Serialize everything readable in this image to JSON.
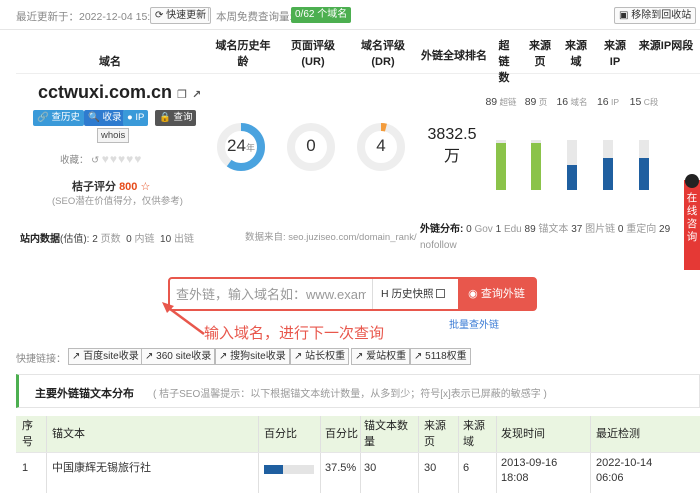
{
  "topbar": {
    "last_update": "最近更新于：2022-12-04 15:23",
    "refresh_label": "快速更新",
    "quota_label": "本周免费查询量:",
    "quota_badge": "0/62 个域名",
    "recycle_label": "移除到回收站"
  },
  "columns": {
    "domain": "域名",
    "age": "域名历史年龄",
    "page_rank": "页面评级(UR)",
    "domain_rank": "域名评级(DR)",
    "global_rank": "外链全球排名",
    "superlinks": "超链数",
    "source_pages": "来源页",
    "source_domains": "来源域",
    "source_ip": "来源IP",
    "source_ip_segments": "来源IP网段"
  },
  "site": {
    "domain": "cctwuxi.com.cn",
    "tags": [
      "查历史",
      "收录",
      "IP",
      "查询"
    ],
    "whois": "whois",
    "collect_label": "收藏：",
    "score_label": "桔子评分",
    "score_value": "800",
    "score_note": "(SEO潜在价值得分，仅供参考)"
  },
  "metrics": {
    "age": "24",
    "age_unit": "年",
    "age_fraction": 0.6,
    "ur": "0",
    "ur_fraction": 0,
    "dr": "4",
    "dr_fraction": 0.04,
    "global_rank": "3832.5万"
  },
  "links": [
    {
      "value": "89",
      "unit": "超链",
      "fraction": 0.95,
      "color": "#8bc34a"
    },
    {
      "value": "89",
      "unit": "页",
      "fraction": 0.95,
      "color": "#8bc34a"
    },
    {
      "value": "16",
      "unit": "域名",
      "fraction": 0.5,
      "color": "#1f5fa0"
    },
    {
      "value": "16",
      "unit": "IP",
      "fraction": 0.65,
      "color": "#1f5fa0"
    },
    {
      "value": "15",
      "unit": "C段",
      "fraction": 0.65,
      "color": "#1f5fa0"
    }
  ],
  "station": {
    "label": "站内数据",
    "estimate": "(估值)",
    "pages_v": "2",
    "pages_u": "页数",
    "inner_v": "0",
    "inner_u": "内链",
    "out_v": "10",
    "out_u": "出链",
    "source_note": "数据来自: seo.juziseo.com/domain_rank/"
  },
  "outlink": {
    "label": "外链分布:",
    "items": [
      {
        "v": "0",
        "u": "Gov"
      },
      {
        "v": "1",
        "u": "Edu"
      },
      {
        "v": "89",
        "u": "锚文本"
      },
      {
        "v": "37",
        "u": "图片链"
      },
      {
        "v": "0",
        "u": "重定向"
      },
      {
        "v": "29",
        "u": "nofollow"
      }
    ]
  },
  "side_widget": "在线咨询",
  "search": {
    "placeholder": "查外链，输入域名如：www.example.com",
    "history_label": "H 历史快照",
    "button": "查询外链",
    "batch_link": "批量查外链"
  },
  "annotation": "输入域名，进行下一次查询",
  "quick": {
    "label": "快捷链接：",
    "buttons": [
      "百度site收录",
      "360 site收录",
      "搜狗site收录",
      "站长权重",
      "爱站权重",
      "5118权重"
    ]
  },
  "section": {
    "title": "主要外链锚文本分布",
    "note": "( 桔子SEO温馨提示：以下根据锚文本统计数量，从多到少；符号[x]表示已屏蔽的敏感字 )"
  },
  "table": {
    "headers": [
      "序号",
      "锚文本",
      "百分比",
      "百分比",
      "锚文本数量",
      "来源页",
      "来源域",
      "发现时间",
      "最近检测"
    ],
    "rows": [
      {
        "idx": "1",
        "anchor": "中国康辉无锡旅行社",
        "pct_fraction": 0.375,
        "pct": "37.5%",
        "count": "30",
        "pages": "30",
        "domains": "6",
        "found": "2013-09-16 18:08",
        "checked": "2022-10-14 06:06"
      }
    ]
  }
}
